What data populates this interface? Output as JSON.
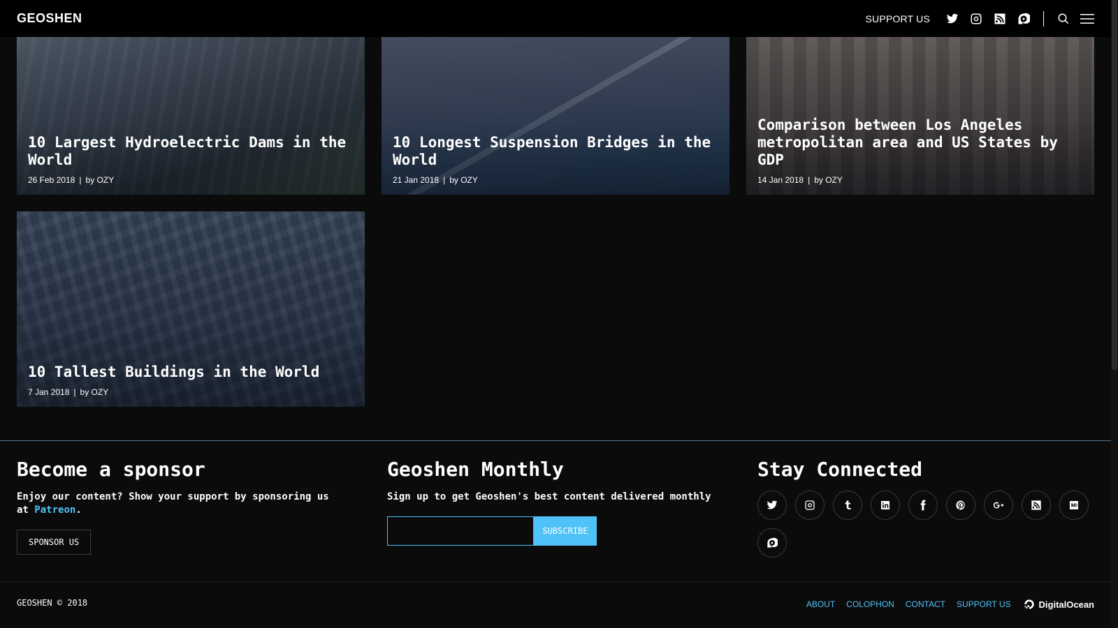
{
  "header": {
    "brand": "GEOSHEN",
    "support_label": "SUPPORT US",
    "icons": [
      "twitter-icon",
      "instagram-icon",
      "rss-icon",
      "patreon-icon",
      "search-icon",
      "menu-icon"
    ]
  },
  "articles": [
    {
      "title": "10 Largest Hydroelectric Dams in the World",
      "date": "26 Feb 2018",
      "separator": "|",
      "author": "by OZY"
    },
    {
      "title": "10 Longest Suspension Bridges in the World",
      "date": "21 Jan 2018",
      "separator": "|",
      "author": "by OZY"
    },
    {
      "title": "Comparison between Los Angeles metropolitan area and US States by GDP",
      "date": "14 Jan 2018",
      "separator": "|",
      "author": "by OZY"
    },
    {
      "title": "10 Tallest Buildings in the World",
      "date": "7 Jan 2018",
      "separator": "|",
      "author": "by OZY"
    }
  ],
  "footer": {
    "sponsor": {
      "heading": "Become a sponsor",
      "text_before": "Enjoy our content? Show your support by sponsoring us at ",
      "link_text": "Patreon",
      "text_after": ".",
      "button_label": "SPONSOR US"
    },
    "monthly": {
      "heading": "Geoshen Monthly",
      "text": "Sign up to get Geoshen's best content delivered monthly",
      "email_value": "",
      "subscribe_label": "SUBSCRIBE"
    },
    "connect": {
      "heading": "Stay Connected",
      "icons": [
        "twitter-icon",
        "instagram-icon",
        "tumblr-icon",
        "linkedin-icon",
        "facebook-icon",
        "pinterest-icon",
        "google-plus-icon",
        "rss-icon",
        "medium-icon",
        "patreon-icon"
      ]
    }
  },
  "bottom": {
    "copyright": "GEOSHEN © 2018",
    "links": [
      "ABOUT",
      "COLOPHON",
      "CONTACT",
      "SUPPORT US"
    ],
    "host": "DigitalOcean"
  },
  "colors": {
    "accent": "#4fc3f7",
    "background": "#0b0b0c",
    "header": "#000000"
  }
}
